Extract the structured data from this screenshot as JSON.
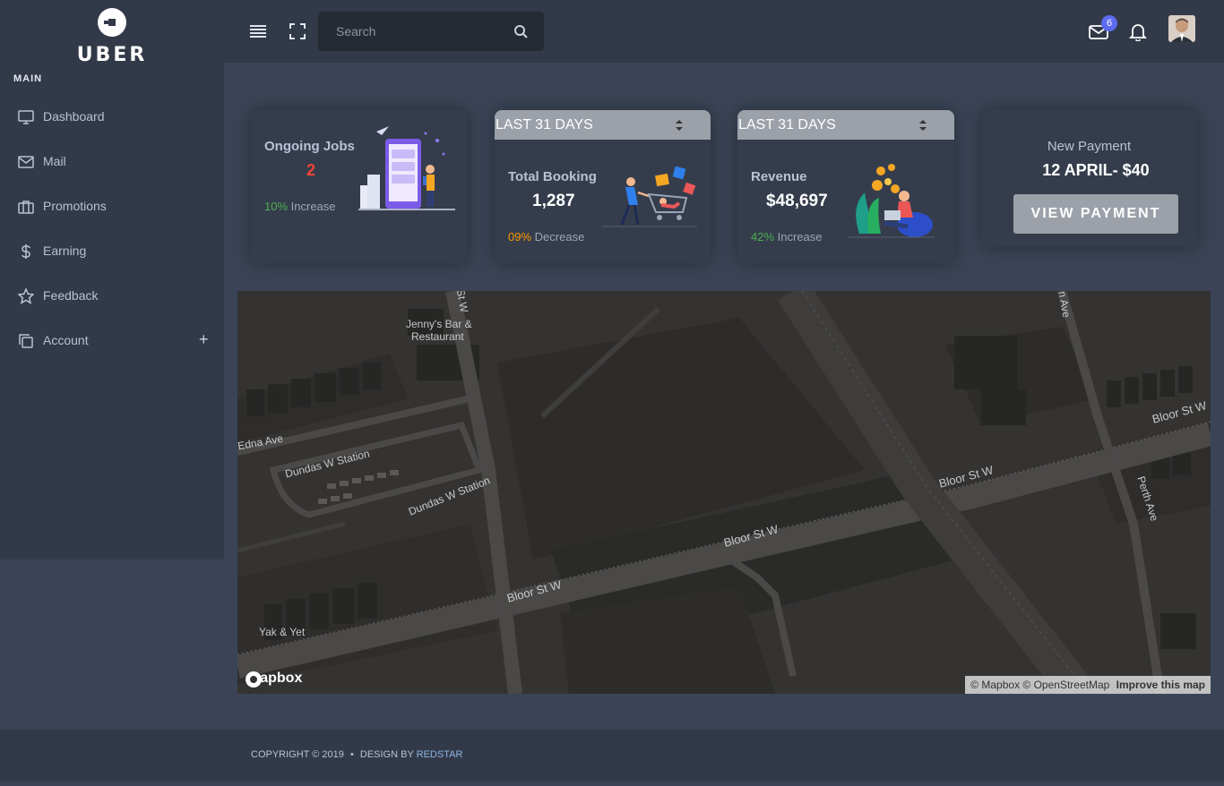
{
  "brand": {
    "name": "UBER"
  },
  "header": {
    "search_placeholder": "Search",
    "mail_badge": "6"
  },
  "sidebar": {
    "section_title": "MAIN",
    "items": [
      {
        "label": "Dashboard",
        "icon": "monitor-icon"
      },
      {
        "label": "Mail",
        "icon": "mail-icon"
      },
      {
        "label": "Promotions",
        "icon": "briefcase-icon"
      },
      {
        "label": "Earning",
        "icon": "dollar-icon"
      },
      {
        "label": "Feedback",
        "icon": "star-icon"
      },
      {
        "label": "Account",
        "icon": "copy-icon",
        "expand": "+"
      }
    ]
  },
  "cards": {
    "ongoing": {
      "title": "Ongoing Jobs",
      "value": "2",
      "change_pct": "10%",
      "change_text": "Increase"
    },
    "booking": {
      "select": "LAST 31 DAYS",
      "title": "Total Booking",
      "value": "1,287",
      "change_pct": "09%",
      "change_text": "Decrease"
    },
    "revenue": {
      "select": "LAST 31 DAYS",
      "title": "Revenue",
      "value": "$48,697",
      "change_pct": "42%",
      "change_text": "Increase"
    },
    "payment": {
      "title": "New Payment",
      "value": "12 APRIL- $40",
      "button": "VIEW PAYMENT"
    }
  },
  "map": {
    "labels": {
      "jennys": "Jenny's Bar &",
      "restaurant": "Restaurant",
      "edna": "Edna Ave",
      "dundas1": "Dundas W Station",
      "dundas2": "Dundas W Station",
      "bloor1": "Bloor St W",
      "bloor2": "Bloor St W",
      "bloor3": "Bloor St W",
      "bloor4": "Bloor St W",
      "perth": "Perth Ave",
      "yak": "Yak & Yet",
      "stw": "St W",
      "nave": "n Ave"
    },
    "attribution": "© Mapbox © OpenStreetMap",
    "improve": "Improve this map",
    "logo": "mapbox"
  },
  "footer": {
    "copyright": "COPYRIGHT © 2019",
    "design_by": "DESIGN BY",
    "designer": "REDSTAR"
  }
}
